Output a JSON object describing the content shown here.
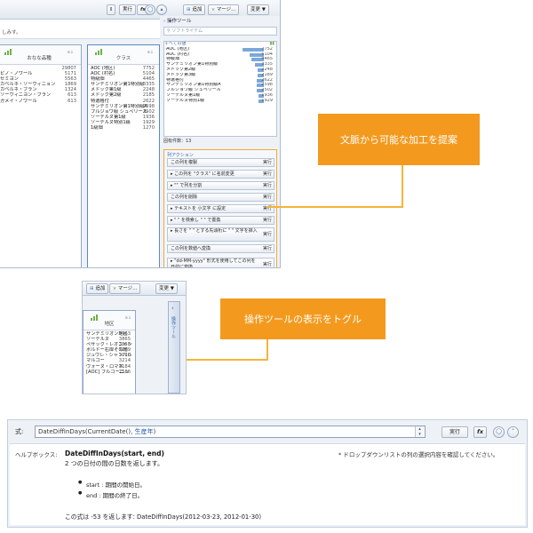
{
  "top_app": {
    "toolbar": {
      "hint": "しみす。",
      "run_label": "実行",
      "fx_label": "fx",
      "add_label": "追加",
      "merge_label": "マージ...",
      "change_label": "変更 ▼"
    },
    "columns": [
      {
        "title": "おなな品種",
        "rows": [
          {
            "name": "",
            "value": "29807"
          },
          {
            "name": "ピノ・ノワール",
            "value": "5171"
          },
          {
            "name": "セミヨン",
            "value": "5563"
          },
          {
            "name": "カベルネ・ソーヴィニョン",
            "value": "1869"
          },
          {
            "name": "カベルネ・フラン",
            "value": "1324"
          },
          {
            "name": "ソーヴィニヨン・ブラン",
            "value": "613"
          },
          {
            "name": "ガメイ・ノワール",
            "value": "613"
          }
        ]
      },
      {
        "title": "クラス",
        "rows": [
          {
            "name": "AOC (地区)",
            "value": "7752"
          },
          {
            "name": "AOC (村名)",
            "value": "5104"
          },
          {
            "name": "特級畑",
            "value": "4465"
          },
          {
            "name": "サンテミリオン第1特別級",
            "value": "3335"
          },
          {
            "name": "メドック第1級",
            "value": "2248"
          },
          {
            "name": "メドック第2級",
            "value": "2185"
          },
          {
            "name": "特選格付",
            "value": "2622"
          },
          {
            "name": "サンテミリオン第1特別級A",
            "value": "2598"
          },
          {
            "name": "ブルジョワ級 シュペリール",
            "value": "2502"
          },
          {
            "name": "ソーテルヌ第1級",
            "value": "1936"
          },
          {
            "name": "ソーテルヌ特別1級",
            "value": "1929"
          },
          {
            "name": "1級畑",
            "value": "1270"
          }
        ]
      }
    ],
    "ops_panel": {
      "header": "操作ツール",
      "search_placeholder": "ソフトライテム",
      "dist_header": "すべての値",
      "dist_rows": [
        {
          "name": "AOC (地区)",
          "value": "7752",
          "fraction": 1.0
        },
        {
          "name": "AOC (村名)",
          "value": "5104",
          "fraction": 0.66
        },
        {
          "name": "特級畑",
          "value": "4465",
          "fraction": 0.58
        },
        {
          "name": "サンテミリオン第1特別級",
          "value": "3335",
          "fraction": 0.43
        },
        {
          "name": "メドック第2級",
          "value": "2248",
          "fraction": 0.29
        },
        {
          "name": "メドック第3級",
          "value": "2189",
          "fraction": 0.28
        },
        {
          "name": "特選格付",
          "value": "2622",
          "fraction": 0.34
        },
        {
          "name": "サンテミリオン第1特別級A",
          "value": "2598",
          "fraction": 0.34
        },
        {
          "name": "ブルジョワ級 シュペリール",
          "value": "2502",
          "fraction": 0.32
        },
        {
          "name": "ソーテルヌ第1級",
          "value": "1936",
          "fraction": 0.25
        },
        {
          "name": "ソーテルヌ特別1級",
          "value": "1929",
          "fraction": 0.25
        }
      ],
      "count_text": "固有件数：13",
      "actions_header": "列アクション",
      "actions": [
        {
          "label": "この列を複製",
          "run": "実行"
        },
        {
          "label": "▸ この列を \"クラス\" に名前変更",
          "run": "実行"
        },
        {
          "label": "▸ \"\" で列を分割",
          "run": "実行"
        },
        {
          "label": "この列を削除",
          "run": "実行"
        },
        {
          "label": "▸ テキストを 小文字 に設定",
          "run": "実行"
        },
        {
          "label": "▸ \" \" を検索し \" \" で置換",
          "run": "実行"
        },
        {
          "label": "▸ 長さを \" \" とする先頭桁に \" \" 文字を挿入",
          "run": "実行"
        },
        {
          "label": "この列を数値へ変換",
          "run": "実行"
        },
        {
          "label": "▸ \"dd-MM-yyyy\" 形式を使用してこの列を日付に変換",
          "run": "実行"
        }
      ]
    }
  },
  "callout_top": "文脈から可能な加工を提案",
  "mid_app": {
    "add_label": "追加",
    "merge_label": "マージ...",
    "change_label": "変更 ▼",
    "column_title": "地区",
    "rows": [
      {
        "name": "サンテミリオン地区",
        "value": "5963"
      },
      {
        "name": "ソーテルヌ",
        "value": "3865"
      },
      {
        "name": "ペサック・レオニャン",
        "value": "3858"
      },
      {
        "name": "ボルドー右岸その他",
        "value": "3269"
      },
      {
        "name": "ジュヴレ・シャンベルタン",
        "value": "3220"
      },
      {
        "name": "マルゴー",
        "value": "3214"
      },
      {
        "name": "ヴォーヌ・ロマネ",
        "value": "3184"
      },
      {
        "name": "[AOC] ブルゴーニュ",
        "value": "2586"
      }
    ],
    "side_tab_label": "操作ツール"
  },
  "callout_mid": "操作ツールの表示をトグル",
  "editor": {
    "formula_label": "式:",
    "formula_fn": "DateDiffInDays(",
    "formula_arg1": "CurrentDate(),",
    "formula_arg2": " 生産年",
    "formula_close": ")",
    "run_label": "実行",
    "fx_label": "fx",
    "help_label": "ヘルプボックス:",
    "help_title": "DateDiffInDays(start, end)",
    "help_desc": "2 つの日付の間の日数を返します。",
    "help_bullet_start": "start : 期間の開始日。",
    "help_bullet_end": "end : 期間の終了日。",
    "help_example": "この式は -53 を返します: DateDiffInDays(2012-03-23, 2012-01-30)",
    "help_note": "* ドロップダウンリストの列の選択内容を確認してください。"
  },
  "colors": {
    "accent_orange": "#f39a1e",
    "link_blue": "#2a5db0",
    "panel_border": "#aebcd0"
  }
}
